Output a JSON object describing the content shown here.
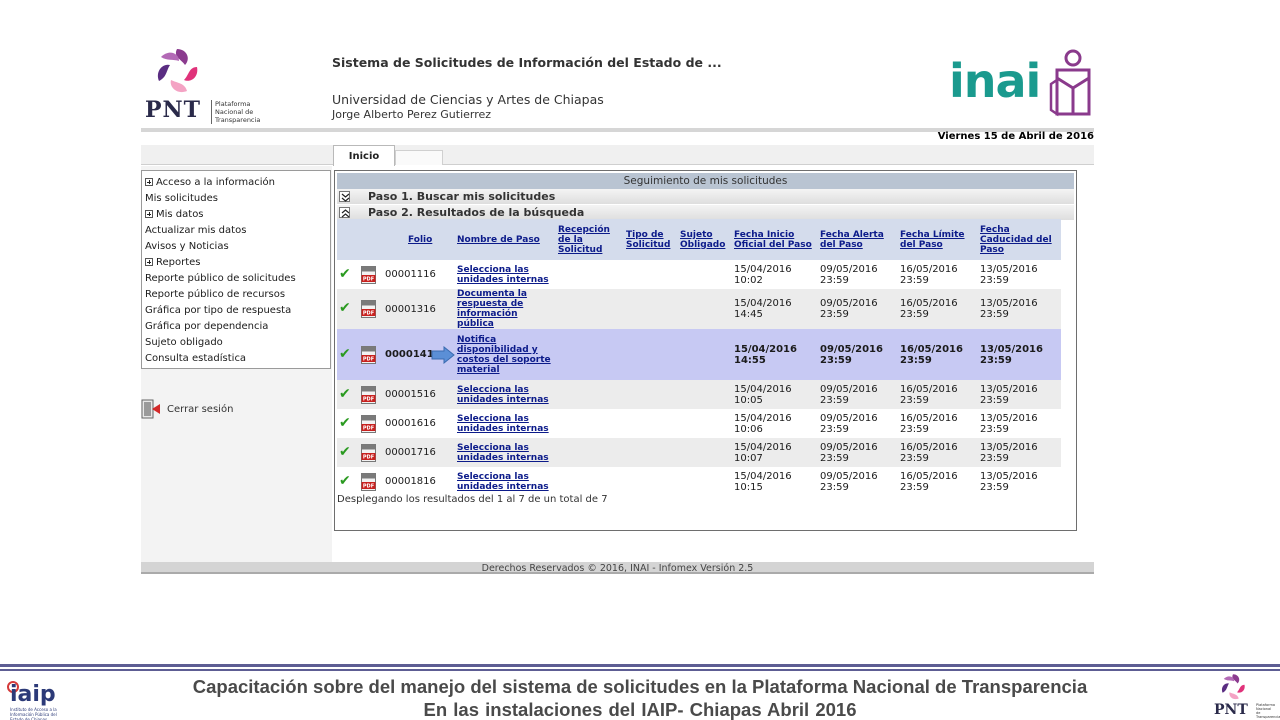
{
  "header": {
    "pnt_logo_text": "PNT",
    "pnt_logo_sub": "Plataforma Nacional de Transparencia",
    "system_title": "Sistema de Solicitudes de Información del Estado de ...",
    "organization": "Universidad de Ciencias y Artes de Chiapas",
    "user": "Jorge Alberto Perez Gutierrez",
    "inai_logo_text": "inai",
    "date": "Viernes 15 de Abril de 2016"
  },
  "tabs": [
    {
      "label": "Inicio",
      "active": true
    }
  ],
  "sidebar": {
    "items": [
      {
        "label": "Acceso a la información",
        "expandable": true
      },
      {
        "label": "Mis solicitudes",
        "expandable": false
      },
      {
        "label": "Mis datos",
        "expandable": true
      },
      {
        "label": "Actualizar mis datos",
        "expandable": false
      },
      {
        "label": "Avisos y Noticias",
        "expandable": false
      },
      {
        "label": "Reportes",
        "expandable": true
      },
      {
        "label": "Reporte público de solicitudes",
        "expandable": false
      },
      {
        "label": "Reporte público de recursos",
        "expandable": false
      },
      {
        "label": "Gráfica por tipo de respuesta",
        "expandable": false
      },
      {
        "label": "Gráfica por dependencia",
        "expandable": false
      },
      {
        "label": "Sujeto obligado",
        "expandable": false
      },
      {
        "label": "Consulta estadística",
        "expandable": false
      }
    ],
    "logout_label": "Cerrar sesión"
  },
  "panel": {
    "title": "Seguimiento de mis solicitudes",
    "step1": "Paso 1. Buscar mis solicitudes",
    "step2": "Paso 2. Resultados de la búsqueda",
    "columns": [
      "",
      "",
      "Folio",
      "Nombre de Paso",
      "Recepción de la Solicitud",
      "Tipo de Solicitud",
      "Sujeto Obligado",
      "Fecha Inicio Oficial del Paso",
      "Fecha Alerta del Paso",
      "Fecha Límite del Paso",
      "Fecha Caducidad del Paso"
    ],
    "rows": [
      {
        "folio": "00001116",
        "step": "Selecciona las unidades internas",
        "inicio": "15/04/2016 10:02",
        "alerta": "09/05/2016 23:59",
        "limite": "16/05/2016 23:59",
        "caducidad": "13/05/2016 23:59",
        "highlight": false
      },
      {
        "folio": "00001316",
        "step": "Documenta la respuesta de información pública",
        "inicio": "15/04/2016 14:45",
        "alerta": "09/05/2016 23:59",
        "limite": "16/05/2016 23:59",
        "caducidad": "13/05/2016 23:59",
        "highlight": false
      },
      {
        "folio": "0000141",
        "step": "Notifica disponibilidad y costos del soporte material",
        "inicio": "15/04/2016 14:55",
        "alerta": "09/05/2016 23:59",
        "limite": "16/05/2016 23:59",
        "caducidad": "13/05/2016 23:59",
        "highlight": true
      },
      {
        "folio": "00001516",
        "step": "Selecciona las unidades internas",
        "inicio": "15/04/2016 10:05",
        "alerta": "09/05/2016 23:59",
        "limite": "16/05/2016 23:59",
        "caducidad": "13/05/2016 23:59",
        "highlight": false
      },
      {
        "folio": "00001616",
        "step": "Selecciona las unidades internas",
        "inicio": "15/04/2016 10:06",
        "alerta": "09/05/2016 23:59",
        "limite": "16/05/2016 23:59",
        "caducidad": "13/05/2016 23:59",
        "highlight": false
      },
      {
        "folio": "00001716",
        "step": "Selecciona las unidades internas",
        "inicio": "15/04/2016 10:07",
        "alerta": "09/05/2016 23:59",
        "limite": "16/05/2016 23:59",
        "caducidad": "13/05/2016 23:59",
        "highlight": false
      },
      {
        "folio": "00001816",
        "step": "Selecciona las unidades internas",
        "inicio": "15/04/2016 10:15",
        "alerta": "09/05/2016 23:59",
        "limite": "16/05/2016 23:59",
        "caducidad": "13/05/2016 23:59",
        "highlight": false
      }
    ],
    "results_count": "Desplegando los resultados del 1 al 7 de un total de 7"
  },
  "footer": {
    "copyright": "Derechos Reservados © 2016, INAI - Infomex Versión 2.5"
  },
  "slide": {
    "caption_line1": "Capacitación sobre del manejo del sistema de solicitudes en la Plataforma Nacional de Transparencia",
    "caption_line2": "En las instalaciones del IAIP- Chiapas    Abril 2016",
    "iaip_logo_text": "iaip",
    "iaip_logo_sub": "Instituto de Acceso a la Información Pública del Estado de Chiapas"
  },
  "icons": [
    "pnt-logo-mark",
    "inai-logo-mark",
    "expand-icon",
    "chevron-down-icon",
    "chevron-up-icon",
    "check-icon",
    "pdf-icon",
    "arrow-right-icon",
    "logout-icon"
  ],
  "colors": {
    "link": "#0c1b8a",
    "highlight_row": "#c7c9f3",
    "header_row": "#d4dcec",
    "inai_teal": "#1a9a8e",
    "check_green": "#2a9a20"
  }
}
